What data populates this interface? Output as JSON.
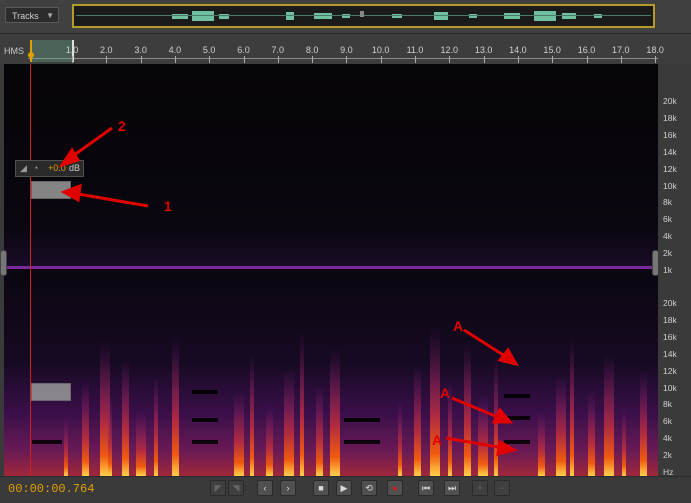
{
  "toolbar": {
    "tracks_label": "Tracks"
  },
  "ruler": {
    "unit_label": "HMS",
    "ticks": [
      "1.0",
      "2.0",
      "3.0",
      "4.0",
      "5.0",
      "6.0",
      "7.0",
      "8.0",
      "9.0",
      "10.0",
      "11.0",
      "12.0",
      "13.0",
      "14.0",
      "15.0",
      "16.0",
      "17.0",
      "18.0"
    ]
  },
  "gain": {
    "value": "+0.0",
    "unit": "dB"
  },
  "freq_axis": {
    "upper": [
      "20k",
      "18k",
      "16k",
      "14k",
      "12k",
      "10k",
      "8k",
      "6k",
      "4k",
      "2k",
      "1k"
    ],
    "lower": [
      "20k",
      "18k",
      "16k",
      "14k",
      "12k",
      "10k",
      "8k",
      "6k",
      "4k",
      "2k",
      "Hz"
    ]
  },
  "annotations": {
    "label_1": "1",
    "label_2": "2",
    "label_a": "A"
  },
  "transport": {
    "timecode": "00:00:00.764"
  },
  "colors": {
    "accent": "#e0a000",
    "annotation": "#e00000",
    "playhead": "#d02020"
  }
}
